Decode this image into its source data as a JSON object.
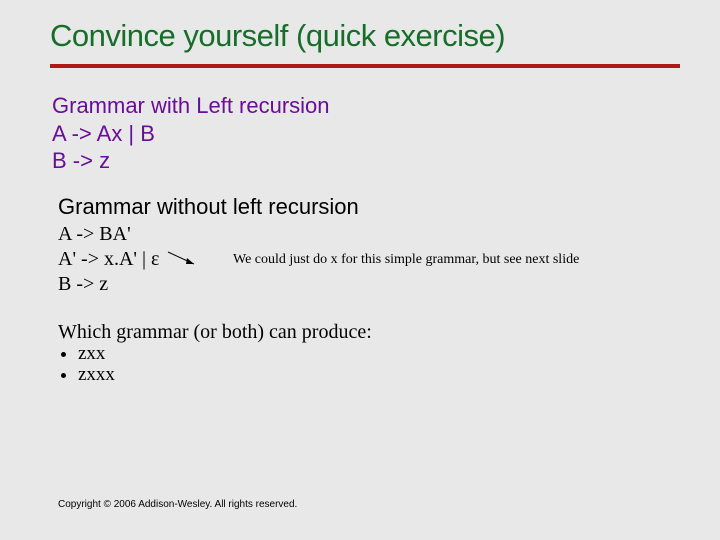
{
  "title": "Convince yourself (quick exercise)",
  "section1": {
    "heading": "Grammar with Left recursion",
    "rule1": "A -> Ax | B",
    "rule2": "B -> z"
  },
  "section2": {
    "heading": "Grammar without left recursion",
    "rule1": "A -> BA'",
    "rule2": "A' -> x.A' | ε",
    "rule3": "B -> z",
    "note": "We could just do x for this simple grammar, but see next slide"
  },
  "section3": {
    "question": "Which grammar (or both) can produce:",
    "items": [
      "zxx",
      "zxxx"
    ]
  },
  "copyright": "Copyright © 2006 Addison-Wesley. All rights reserved."
}
